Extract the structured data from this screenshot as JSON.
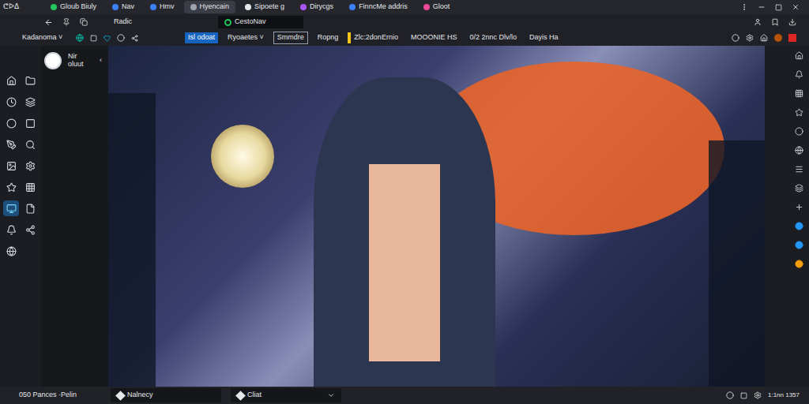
{
  "app": {
    "logo": "ᕦᐅᐃ",
    "account": "Kadanoma",
    "account_caret": "˅"
  },
  "tabs": [
    {
      "label": "Gloub Biuly",
      "selected": false
    },
    {
      "label": "Nav",
      "selected": false
    },
    {
      "label": "Hmv",
      "selected": false
    },
    {
      "label": "Hyencain",
      "selected": true
    },
    {
      "label": "Sipoete g",
      "selected": false
    },
    {
      "label": "Dirycgs",
      "selected": false
    },
    {
      "label": "FinncMe addris",
      "selected": false
    },
    {
      "label": "Gloot",
      "selected": false
    }
  ],
  "toolbar": {
    "title": "Radic",
    "address": "CestoNav",
    "chips": [
      {
        "label": "Isl odoat",
        "kind": "highlight"
      },
      {
        "label": "Ryoaetes ˅",
        "kind": "plain"
      },
      {
        "label": "Smmdre",
        "kind": "boxed"
      },
      {
        "label": "Ropng",
        "kind": "plain"
      },
      {
        "label": "Zlc:2donErnio",
        "kind": "marked"
      },
      {
        "label": "MOOONIE HS",
        "kind": "plain"
      },
      {
        "label": "0/2 2nnc Dlv/lo",
        "kind": "plain"
      },
      {
        "label": "Dayis Ha",
        "kind": "plain"
      }
    ]
  },
  "panel": {
    "user": {
      "name": "Nir",
      "status": "oluut"
    },
    "collapse": "‹"
  },
  "sidebar": {
    "items": [
      {
        "selected": false
      },
      {
        "selected": false
      },
      {
        "selected": false
      },
      {
        "selected": false
      },
      {
        "selected": false
      },
      {
        "selected": false
      },
      {
        "selected": false
      },
      {
        "selected": false
      },
      {
        "selected": false
      },
      {
        "selected": false
      },
      {
        "selected": false
      },
      {
        "selected": false
      },
      {
        "selected": true
      },
      {
        "selected": false
      },
      {
        "selected": false
      },
      {
        "selected": false
      },
      {
        "selected": false
      }
    ]
  },
  "right_rail": {
    "items": [
      {
        "color": "#d1d5db"
      },
      {
        "color": "#d1d5db"
      },
      {
        "color": "#d1d5db"
      },
      {
        "color": "#d1d5db"
      },
      {
        "color": "#d1d5db"
      },
      {
        "color": "#d1d5db"
      },
      {
        "color": "#d1d5db"
      },
      {
        "color": "#d1d5db"
      },
      {
        "color": "#d1d5db"
      },
      {
        "color": "#2196f3"
      },
      {
        "color": "#2196f3"
      },
      {
        "color": "#f59e0b"
      }
    ]
  },
  "status_bar": {
    "left": "050 Pances ·Pelin",
    "tabs": [
      {
        "label": "Nalnecy"
      },
      {
        "label": "Cliat"
      }
    ],
    "time": "1:1nn 1357"
  }
}
